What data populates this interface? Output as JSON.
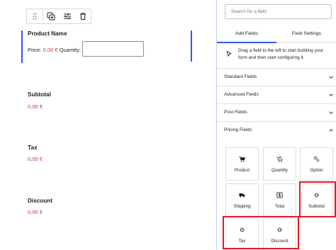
{
  "canvas": {
    "product": {
      "title": "Product Name",
      "price_label": "Price: ",
      "price_value": "0,00 €",
      "quantity_label": " Quantity: "
    },
    "subtotal": {
      "title": "Subtotal",
      "value": "0,00 €"
    },
    "tax": {
      "title": "Tax",
      "value": "0,00 €"
    },
    "discount": {
      "title": "Discount",
      "value": "0,00 €"
    }
  },
  "toolbar": {
    "icons": [
      "drag-handle-icon",
      "duplicate-icon",
      "settings-sliders-icon",
      "trash-icon"
    ]
  },
  "sidebar": {
    "search": {
      "placeholder": "Search for a field"
    },
    "tabs": [
      {
        "label": "Add Fields",
        "active": true
      },
      {
        "label": "Field Settings",
        "active": false
      }
    ],
    "hint": "Drag a field to the left to start building your form and then start configuring it.",
    "sections": [
      {
        "label": "Standard Fields",
        "expanded": false
      },
      {
        "label": "Advanced Fields",
        "expanded": false
      },
      {
        "label": "Post Fields",
        "expanded": false
      },
      {
        "label": "Pricing Fields",
        "expanded": true
      }
    ],
    "pricing_fields": [
      {
        "label": "Product",
        "icon": "cart-icon"
      },
      {
        "label": "Quantity",
        "icon": "cart-plus-icon"
      },
      {
        "label": "Option",
        "icon": "gear-icon"
      },
      {
        "label": "Shipping",
        "icon": "truck-icon"
      },
      {
        "label": "Total",
        "icon": "money-icon"
      },
      {
        "label": "Subtotal",
        "icon": "gear-icon"
      },
      {
        "label": "Tax",
        "icon": "gear-icon"
      },
      {
        "label": "Discount",
        "icon": "gear-icon"
      }
    ]
  },
  "colors": {
    "accent": "#3858e9",
    "price_red": "#d63638",
    "highlight_red": "#e11b22"
  }
}
